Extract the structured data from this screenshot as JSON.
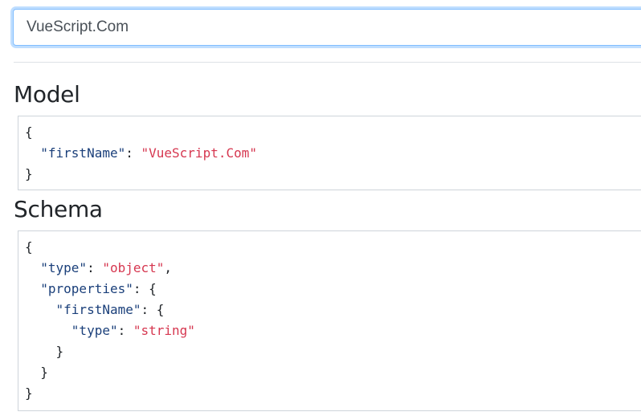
{
  "input": {
    "value": "VueScript.Com"
  },
  "model_section": {
    "title": "Model",
    "json": {
      "firstName": "VueScript.Com"
    }
  },
  "schema_section": {
    "title": "Schema",
    "json": {
      "type": "object",
      "properties": {
        "firstName": {
          "type": "string"
        }
      }
    }
  },
  "colors": {
    "json_key": "#1a3f7a",
    "json_string": "#d63750",
    "input_focus_border": "#80bdff",
    "border": "#ced4da"
  }
}
